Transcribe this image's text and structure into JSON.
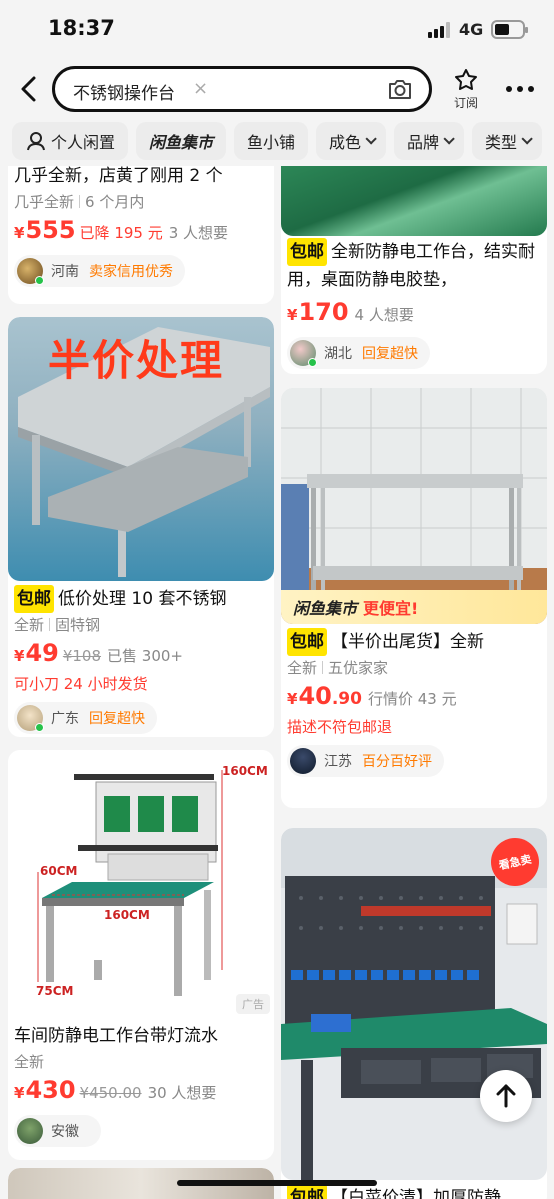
{
  "status": {
    "time": "18:37",
    "network": "4G"
  },
  "header": {
    "query": "不锈钢操作台",
    "clear": "×",
    "subscribe_label": "订阅"
  },
  "filters": {
    "chips": [
      {
        "label": "个人闲置",
        "has_icon": true,
        "dropdown": false
      },
      {
        "label": "闲鱼集市",
        "has_icon": false,
        "dropdown": false
      },
      {
        "label": "鱼小铺",
        "has_icon": false,
        "dropdown": false
      },
      {
        "label": "成色",
        "has_icon": false,
        "dropdown": true
      },
      {
        "label": "品牌",
        "has_icon": false,
        "dropdown": true
      },
      {
        "label": "类型",
        "has_icon": false,
        "dropdown": true
      }
    ]
  },
  "items": [
    {
      "title": "几乎全新，店黄了刚用 2 个",
      "meta": [
        "几乎全新",
        "6 个月内"
      ],
      "price_int": "555",
      "price_dec": "",
      "price_note": "已降 195 元",
      "old_price": "",
      "want": "3 人想要",
      "location": "河南",
      "badge": "卖家信用优秀"
    },
    {
      "tag": "包邮",
      "title": "全新防静电工作台，结实耐用，桌面防静电胶垫，",
      "price_int": "170",
      "price_dec": "",
      "want": "4 人想要",
      "location": "湖北",
      "badge": "回复超快"
    },
    {
      "overlay": "半价处理",
      "tag": "包邮",
      "title": "低价处理 10 套不锈钢",
      "meta": [
        "全新",
        "固特钢"
      ],
      "price_int": "49",
      "price_dec": "",
      "old_price": "¥108",
      "want": "已售 300+",
      "promo": "可小刀  24 小时发货",
      "location": "广东",
      "badge": "回复超快"
    },
    {
      "banner_brand": "闲鱼集市",
      "banner_text": "更便宜!",
      "tag": "包邮",
      "title": "【半价出尾货】全新",
      "meta": [
        "全新",
        "五优家家"
      ],
      "price_int": "40",
      "price_dec": ".90",
      "price_note_gray": "行情价 43 元",
      "promo": "描述不符包邮退",
      "location": "江苏",
      "badge": "百分百好评"
    },
    {
      "dims": [
        "160CM",
        "60CM",
        "160CM",
        "75CM"
      ],
      "ad": "广告",
      "title": "车间防静电工作台带灯流水",
      "meta": [
        "全新"
      ],
      "price_int": "430",
      "price_dec": "",
      "old_price": "¥450.00",
      "want": "30 人想要",
      "location": "安徽",
      "badge": ""
    },
    {
      "sticker": "看急卖",
      "tag": "包邮",
      "title": "【白菜价清】加厚防静"
    }
  ],
  "colors": {
    "price": "#ff3b30",
    "badge": "#ff7a00",
    "tag_bg": "#ffe400",
    "online": "#26c24a"
  }
}
